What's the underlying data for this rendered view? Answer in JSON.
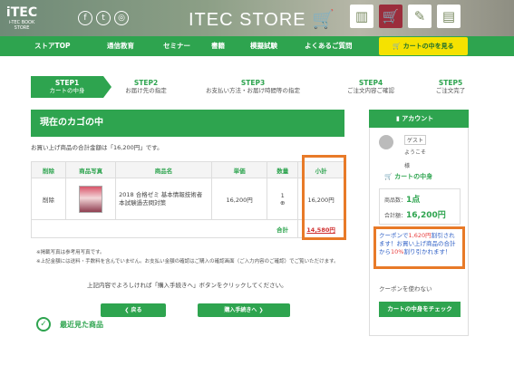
{
  "header": {
    "logo": "iTEC",
    "logo_sub": "i-TEC BOOK STORE",
    "store_name": "ITEC STORE",
    "social": [
      "f",
      "t",
      "◎"
    ]
  },
  "nav": {
    "items": [
      "ストアTOP",
      "通信教育",
      "セミナー",
      "書籍",
      "模擬試験",
      "よくあるご質問"
    ],
    "cart_label": "カートの中を見る"
  },
  "steps": [
    {
      "label": "STEP1",
      "text": "カートの中身"
    },
    {
      "label": "STEP2",
      "text": "お届け先の指定"
    },
    {
      "label": "STEP3",
      "text": "お支払い方法・お届け時間等の指定"
    },
    {
      "label": "STEP4",
      "text": "ご注文内容ご確認"
    },
    {
      "label": "STEP5",
      "text": "ご注文完了"
    }
  ],
  "main": {
    "title": "現在のカゴの中",
    "summary": "お買い上げ商品の合計金額は「16,200円」です。",
    "columns": [
      "削除",
      "商品写真",
      "商品名",
      "単価",
      "数量",
      "小計"
    ],
    "row": {
      "delete": "削除",
      "name": "2018 合格ゼミ 基本情報技術者 本試験過去問対策",
      "price": "16,200円",
      "qty": "1",
      "subtotal": "16,200円"
    },
    "total_label": "合計",
    "total": "14,580円",
    "note1": "※掲載写真は参考用写真です。",
    "note2": "※上記金額には送料・手数料を含んでいません。お支払い金額の確認はご購入の確認画面（ご入力内容のご確認）でご覧いただけます。",
    "message": "上記内容でよろしければ「購入手続きへ」ボタンをクリックしてください。",
    "back_button": "戻る",
    "proceed_button": "購入手続きへ",
    "recent": "最近見た商品"
  },
  "sidebar": {
    "title": "アカウント",
    "guest": "ゲスト",
    "welcome": "ようこそ",
    "sama": "様",
    "cart_title": "カートの中身",
    "item_count_label": "商品数：",
    "item_count": "1点",
    "total_label": "合計額：",
    "total": "16,200円",
    "coupon_text_1": "クーポンで",
    "coupon_amount": "1,620円",
    "coupon_text_2": "割引されます！お買い上げ商品の合計から",
    "coupon_pct": "10%",
    "coupon_text_3": "割り引かれます！",
    "no_coupon": "クーポンを使わない",
    "check_button": "カートの中身をチェック"
  },
  "colors": {
    "brand": "#2ea44f",
    "highlight": "#e87a28",
    "nav_cart": "#f5e200"
  }
}
